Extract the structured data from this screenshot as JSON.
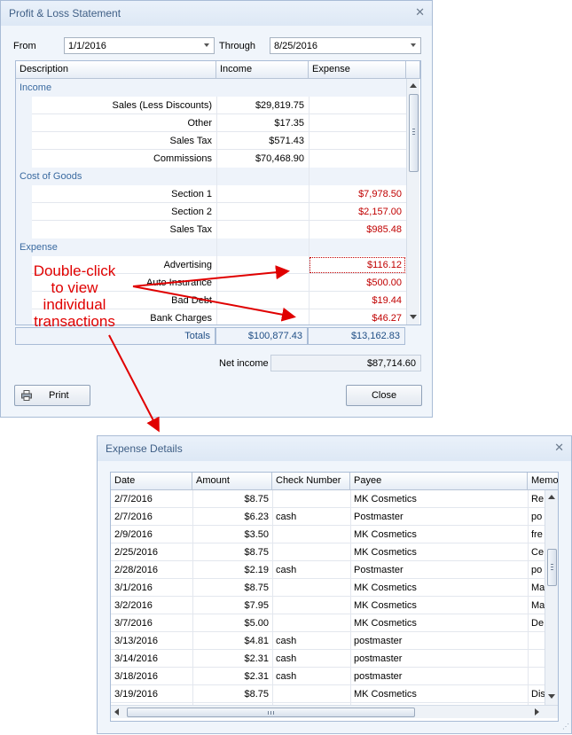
{
  "pl": {
    "title": "Profit & Loss Statement",
    "from_label": "From",
    "from_value": "1/1/2016",
    "through_label": "Through",
    "through_value": "8/25/2016",
    "columns": [
      "Description",
      "Income",
      "Expense"
    ],
    "groups": {
      "income": "Income",
      "cogs": "Cost of Goods",
      "expense": "Expense"
    },
    "rows": [
      {
        "desc": "Sales (Less Discounts)",
        "income": "$29,819.75",
        "expense": ""
      },
      {
        "desc": "Other",
        "income": "$17.35",
        "expense": ""
      },
      {
        "desc": "Sales Tax",
        "income": "$571.43",
        "expense": ""
      },
      {
        "desc": "Commissions",
        "income": "$70,468.90",
        "expense": ""
      },
      {
        "desc": "Section 1",
        "income": "",
        "expense": "$7,978.50"
      },
      {
        "desc": "Section 2",
        "income": "",
        "expense": "$2,157.00"
      },
      {
        "desc": "Sales Tax",
        "income": "",
        "expense": "$985.48"
      },
      {
        "desc": "Advertising",
        "income": "",
        "expense": "$116.12"
      },
      {
        "desc": "Auto Insurance",
        "income": "",
        "expense": "$500.00"
      },
      {
        "desc": "Bad Debt",
        "income": "",
        "expense": "$19.44"
      },
      {
        "desc": "Bank Charges",
        "income": "",
        "expense": "$46.27"
      }
    ],
    "totals_label": "Totals",
    "total_income": "$100,877.43",
    "total_expense": "$13,162.83",
    "net_income_label": "Net income",
    "net_income_value": "$87,714.60",
    "print_label": "Print",
    "close_label": "Close"
  },
  "annotation": [
    "Double-click",
    "to view",
    "individual",
    "transactions"
  ],
  "ed": {
    "title": "Expense Details",
    "columns": [
      "Date",
      "Amount",
      "Check Number",
      "Payee",
      "Memo"
    ],
    "rows": [
      {
        "date": "2/7/2016",
        "amount": "$8.75",
        "check": "",
        "payee": "MK Cosmetics",
        "memo": "Re"
      },
      {
        "date": "2/7/2016",
        "amount": "$6.23",
        "check": "cash",
        "payee": "Postmaster",
        "memo": "po"
      },
      {
        "date": "2/9/2016",
        "amount": "$3.50",
        "check": "",
        "payee": "MK Cosmetics",
        "memo": "fre"
      },
      {
        "date": "2/25/2016",
        "amount": "$8.75",
        "check": "",
        "payee": "MK Cosmetics",
        "memo": "Ce"
      },
      {
        "date": "2/28/2016",
        "amount": "$2.19",
        "check": "cash",
        "payee": "Postmaster",
        "memo": "po"
      },
      {
        "date": "3/1/2016",
        "amount": "$8.75",
        "check": "",
        "payee": "MK Cosmetics",
        "memo": "Ma"
      },
      {
        "date": "3/2/2016",
        "amount": "$7.95",
        "check": "",
        "payee": "MK Cosmetics",
        "memo": "Ma"
      },
      {
        "date": "3/7/2016",
        "amount": "$5.00",
        "check": "",
        "payee": "MK Cosmetics",
        "memo": "De"
      },
      {
        "date": "3/13/2016",
        "amount": "$4.81",
        "check": "cash",
        "payee": "postmaster",
        "memo": ""
      },
      {
        "date": "3/14/2016",
        "amount": "$2.31",
        "check": "cash",
        "payee": "postmaster",
        "memo": ""
      },
      {
        "date": "3/18/2016",
        "amount": "$2.31",
        "check": "cash",
        "payee": "postmaster",
        "memo": ""
      },
      {
        "date": "3/19/2016",
        "amount": "$8.75",
        "check": "",
        "payee": "MK Cosmetics",
        "memo": "Dis"
      }
    ]
  },
  "colors": {
    "accent": "#3a6aa0",
    "expense_red": "#c00000",
    "annotation_red": "#e00000"
  }
}
